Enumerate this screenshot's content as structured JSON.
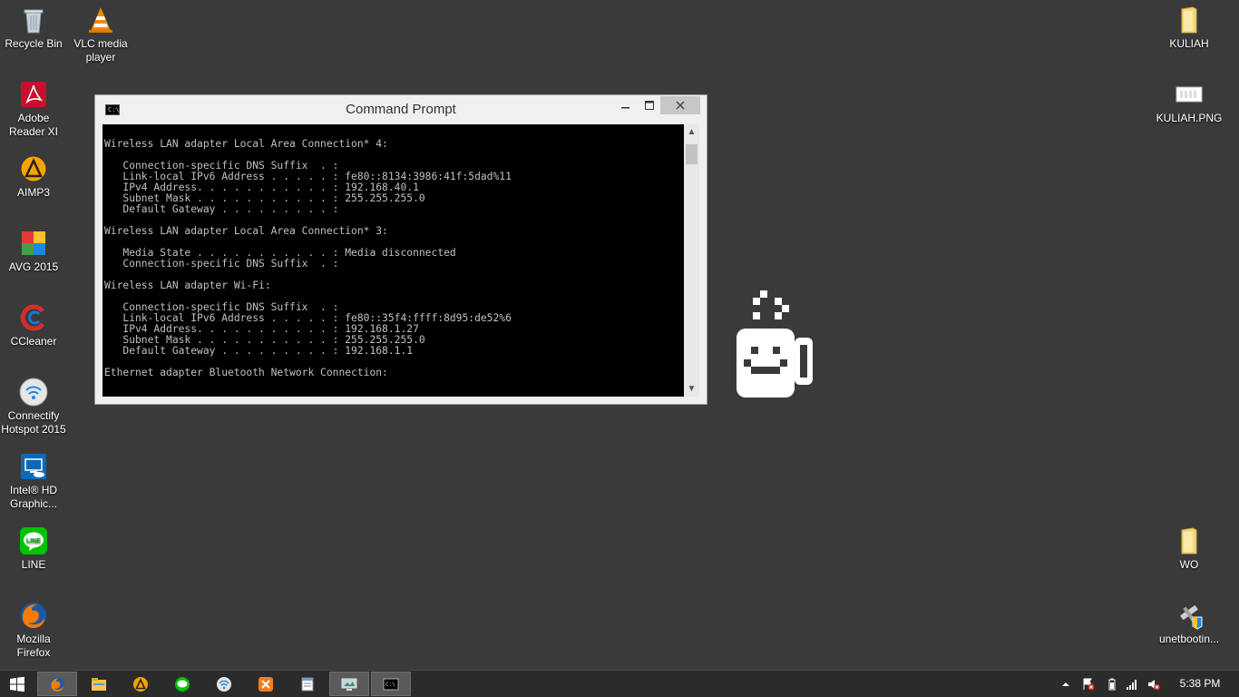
{
  "desktop_icons": {
    "recycle_bin": "Recycle Bin",
    "vlc": "VLC media player",
    "adobe": "Adobe Reader XI",
    "aimp": "AIMP3",
    "avg": "AVG 2015",
    "ccleaner": "CCleaner",
    "connectify": "Connectify Hotspot 2015",
    "intel": "Intel® HD Graphic...",
    "line": "LINE",
    "firefox": "Mozilla Firefox",
    "kuliah_folder": "KULIAH",
    "kuliah_png": "KULIAH.PNG",
    "wo_folder": "WO",
    "unetbootin": "unetbootin..."
  },
  "cmd_window": {
    "title": "Command Prompt",
    "output": "\nWireless LAN adapter Local Area Connection* 4:\n\n   Connection-specific DNS Suffix  . :\n   Link-local IPv6 Address . . . . . : fe80::8134:3986:41f:5dad%11\n   IPv4 Address. . . . . . . . . . . : 192.168.40.1\n   Subnet Mask . . . . . . . . . . . : 255.255.255.0\n   Default Gateway . . . . . . . . . :\n\nWireless LAN adapter Local Area Connection* 3:\n\n   Media State . . . . . . . . . . . : Media disconnected\n   Connection-specific DNS Suffix  . :\n\nWireless LAN adapter Wi-Fi:\n\n   Connection-specific DNS Suffix  . :\n   Link-local IPv6 Address . . . . . : fe80::35f4:ffff:8d95:de52%6\n   IPv4 Address. . . . . . . . . . . : 192.168.1.27\n   Subnet Mask . . . . . . . . . . . : 255.255.255.0\n   Default Gateway . . . . . . . . . : 192.168.1.1\n\nEthernet adapter Bluetooth Network Connection:",
    "icon": "cmd-icon",
    "controls": [
      "minimize-icon",
      "maximize-icon",
      "close-icon"
    ]
  },
  "taskbar": {
    "start_icon": "windows-logo-icon",
    "pinned": [
      "firefox-icon",
      "file-explorer-icon",
      "aimp-icon",
      "line-icon",
      "connectify-icon",
      "xampp-icon",
      "notepad-icon",
      "display-settings-icon",
      "cmd-icon"
    ],
    "active_items": [
      "firefox-icon",
      "display-settings-icon",
      "cmd-icon"
    ],
    "tray": [
      "show-hidden-icons-icon",
      "action-center-icon",
      "battery-icon",
      "network-signal-icon",
      "volume-muted-icon"
    ],
    "clock": "5:38 PM"
  },
  "colors": {
    "desktop_background": "#3a3a3a",
    "taskbar": "#2b2b2b",
    "console_background": "#000000",
    "console_text": "#c0c0c0"
  }
}
